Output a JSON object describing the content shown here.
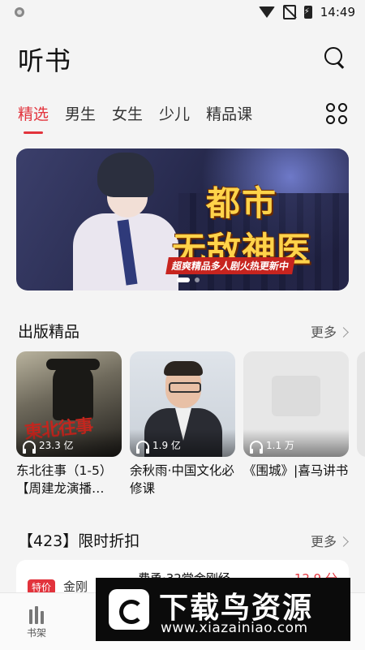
{
  "status_bar": {
    "time": "14:49"
  },
  "header": {
    "title": "听书"
  },
  "tabs": [
    {
      "label": "精选",
      "active": true
    },
    {
      "label": "男生"
    },
    {
      "label": "女生"
    },
    {
      "label": "少儿"
    },
    {
      "label": "精品课"
    }
  ],
  "banner": {
    "title_line1": "都市",
    "title_line2": "无敌神医",
    "tagline": "超爽精品多人剧火热更新中",
    "slide_count": 2,
    "current_slide": 1
  },
  "section_published": {
    "title": "出版精品",
    "more": "更多",
    "items": [
      {
        "cover_text": "東北往事",
        "plays": "23.3 亿",
        "title": "东北往事（1-5）【周建龙演播…"
      },
      {
        "plays": "1.9 亿",
        "title": "余秋雨·中国文化必修课"
      },
      {
        "plays": "1.1 万",
        "title": "《围城》|喜马讲书"
      }
    ]
  },
  "section_discount": {
    "title": "【423】限时折扣",
    "more": "更多",
    "item": {
      "badge": "特价",
      "badge_ext": "金刚",
      "title": "费勇·32堂金刚经",
      "price": "12.9 分"
    }
  },
  "bottom_nav": {
    "shelf_label": "书架"
  },
  "watermark": {
    "brand": "下载鸟资源",
    "url": "www.xiazainiao.com"
  },
  "colors": {
    "accent": "#e2333c",
    "background": "#f4f4f4"
  }
}
